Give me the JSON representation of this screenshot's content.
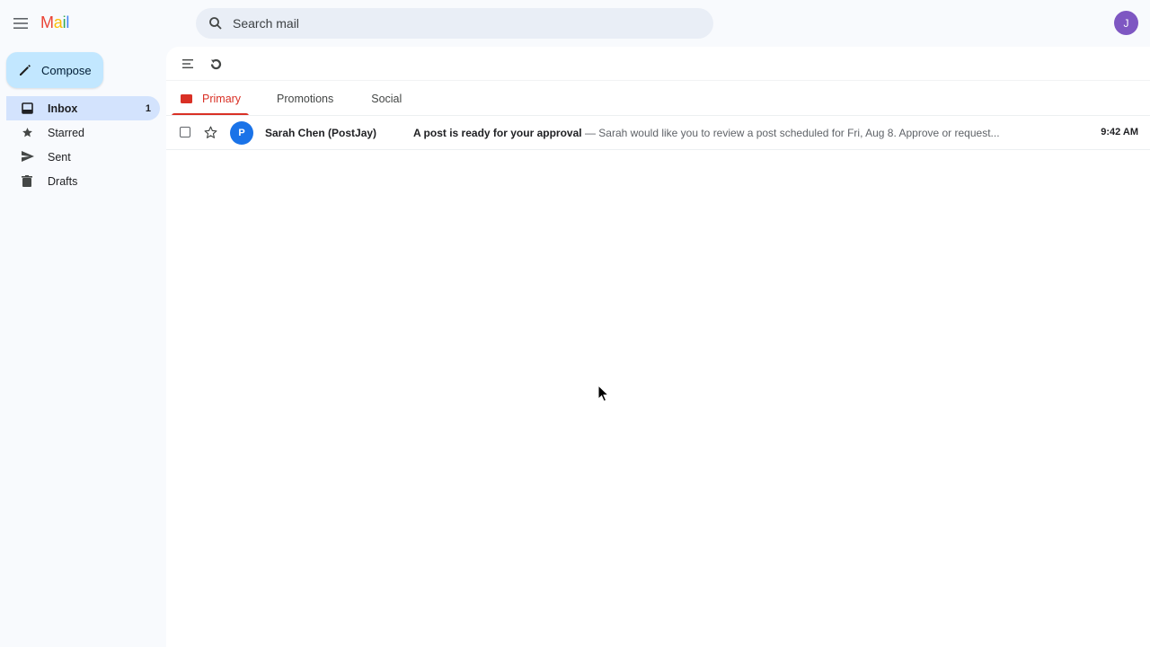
{
  "app": {
    "logo_letters": [
      "M",
      "a",
      "i",
      "l"
    ],
    "search": {
      "placeholder": "Search mail"
    },
    "account_initial": "J"
  },
  "sidebar": {
    "compose_label": "Compose",
    "items": [
      {
        "label": "Inbox",
        "count": "1",
        "icon": "inbox-icon",
        "active": true
      },
      {
        "label": "Starred",
        "count": "",
        "icon": "star-icon",
        "active": false
      },
      {
        "label": "Sent",
        "count": "",
        "icon": "send-icon",
        "active": false
      },
      {
        "label": "Drafts",
        "count": "",
        "icon": "drafts-icon",
        "active": false
      }
    ]
  },
  "tabs": [
    {
      "label": "Primary",
      "icon": "inbox-tab-icon",
      "active": true
    },
    {
      "label": "Promotions",
      "active": false
    },
    {
      "label": "Social",
      "active": false
    }
  ],
  "emails": [
    {
      "avatar_letter": "P",
      "sender": "Sarah Chen (PostJay)",
      "subject": "A post is ready for your approval",
      "separator": " — ",
      "snippet": "Sarah would like you to review a post scheduled for Fri, Aug 8. Approve or request...",
      "time": "9:42 AM",
      "unread": true
    }
  ],
  "colors": {
    "accent_red": "#d93025",
    "compose_bg": "#c2e7ff",
    "active_nav": "#d3e3fd",
    "avatar_purple": "#7e57c2",
    "avatar_blue": "#1a73e8"
  }
}
